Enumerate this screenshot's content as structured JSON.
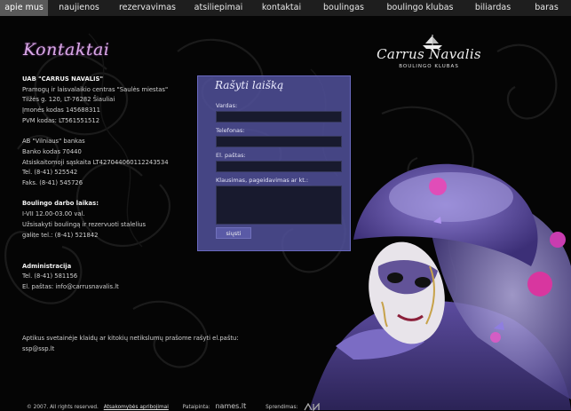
{
  "nav": {
    "items": [
      {
        "label": "apie mus",
        "active": true
      },
      {
        "label": "naujienos",
        "active": false
      },
      {
        "label": "rezervavimas",
        "active": false
      },
      {
        "label": "atsiliepimai",
        "active": false
      },
      {
        "label": "kontaktai",
        "active": false
      },
      {
        "label": "boulingas",
        "active": false
      },
      {
        "label": "boulingo klubas",
        "active": false
      },
      {
        "label": "biliardas",
        "active": false
      },
      {
        "label": "baras",
        "active": false
      }
    ]
  },
  "page": {
    "title": "Kontaktai"
  },
  "logo": {
    "name": "Carrus Navalis",
    "subtitle": "BOULINGO KLUBAS"
  },
  "company": {
    "name": "UAB \"CARRUS NAVALIS\"",
    "lines": [
      "Pramogų ir laisvalaikio centras \"Saulės miestas\"",
      "Tilžės g. 120, LT-76282 Šiauliai",
      "Įmonės kodas 145688311",
      "PVM kodas: LT561551512"
    ]
  },
  "bank": {
    "lines": [
      "AB \"Vilniaus\" bankas",
      "Banko kodas 70440",
      "Atsiskaitomoji sąskaita LT427044060112243534",
      "Tel. (8-41) 525542",
      "Faks. (8-41) 545726"
    ]
  },
  "hours": {
    "heading": "Boulingo darbo laikas:",
    "lines": [
      "I-VII 12.00-03.00 val.",
      "Užsisakyti boulingą ir rezervuoti stalelius",
      "galite tel.: (8-41) 521842"
    ]
  },
  "admin": {
    "heading": "Administracija",
    "lines": [
      "Tel. (8-41) 581156",
      "El. paštas: info@carrusnavalis.lt"
    ]
  },
  "note": {
    "line1": "Aptikus svetainėje klaidų ar kitokių netikslumų prašome rašyti el.paštu:",
    "line2": "ssp@ssp.lt"
  },
  "form": {
    "title": "Rašyti laišką",
    "name_label": "Vardas:",
    "name_value": "",
    "phone_label": "Telefonas:",
    "phone_value": "",
    "email_label": "El. paštas:",
    "email_value": "",
    "message_label": "Klausimas, pageidavimas ar kt.:",
    "message_value": "",
    "submit_label": "siųsti"
  },
  "footer": {
    "copyright": "© 2007. All rights reserved.",
    "disclaimer_link": "Atsakomybės apribojimai",
    "made_by_label": "Pataipinta:",
    "made_by_name": "names.lt",
    "solutions_label": "Sprendimas:"
  },
  "colors": {
    "accent": "#d9a8e6",
    "form_bg": "#4e4e96",
    "nav_bg": "#1e1e1e",
    "nav_active": "#5a5a5a"
  }
}
